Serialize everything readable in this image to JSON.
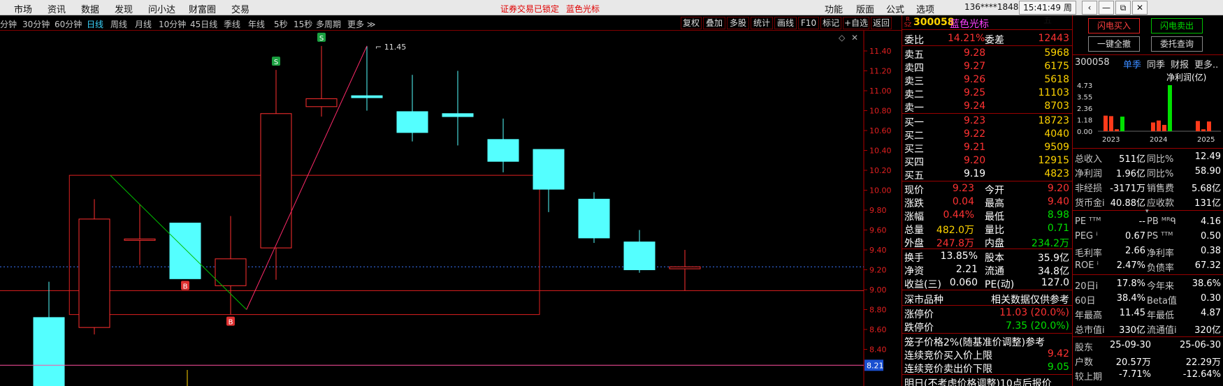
{
  "menu": [
    "市场",
    "资讯",
    "数据",
    "发现",
    "问小达",
    "财富圈",
    "交易"
  ],
  "notice": [
    "证券交易已锁定",
    "蓝色光标"
  ],
  "tools": [
    "功能",
    "版面",
    "公式",
    "选项"
  ],
  "user": "136****1848",
  "clock": "15:41:49 周五",
  "window_icons": [
    "back-icon",
    "minimize-icon",
    "restore-icon",
    "close-icon"
  ],
  "periods": [
    "分钟",
    "30分钟",
    "60分钟",
    "日线",
    "周线",
    "月线",
    "10分钟",
    "45日线",
    "季线",
    "年线",
    "5秒",
    "15秒",
    "多周期",
    "更多"
  ],
  "active_period": "日线",
  "chart_tools": [
    "复权",
    "叠加",
    "多股",
    "统计",
    "画线",
    "F10",
    "标记",
    "+自选",
    "返回"
  ],
  "chart_data": {
    "type": "candlestick",
    "y_ticks": [
      "11.40",
      "11.20",
      "11.00",
      "10.80",
      "10.60",
      "10.40",
      "10.20",
      "10.00",
      "9.80",
      "9.60",
      "9.40",
      "9.20",
      "9.00",
      "8.80",
      "8.60",
      "8.40",
      "8.21"
    ],
    "ylim": [
      8.22,
      11.5
    ],
    "current_price_line": 9.23,
    "support_line": 9.0,
    "crosshair_value": "8.21",
    "high_label": "11.45",
    "candles": [
      {
        "o": 8.72,
        "c": 7.55,
        "h": 9.08,
        "l": 7.2
      },
      {
        "o": 8.62,
        "c": 9.71,
        "h": 9.91,
        "l": 8.55
      },
      {
        "o": 9.51,
        "c": 9.51,
        "h": 9.86,
        "l": 9.25
      },
      {
        "o": 9.67,
        "c": 9.11,
        "h": 9.67,
        "l": 9.11
      },
      {
        "o": 9.04,
        "c": 9.31,
        "h": 9.74,
        "l": 8.75
      },
      {
        "o": 9.42,
        "c": 10.77,
        "h": 11.21,
        "l": 9.1
      },
      {
        "o": 10.84,
        "c": 10.92,
        "h": 11.45,
        "l": 10.74
      },
      {
        "o": 10.95,
        "c": 10.93,
        "h": 11.45,
        "l": 10.8
      },
      {
        "o": 10.79,
        "c": 10.58,
        "h": 11.16,
        "l": 10.49
      },
      {
        "o": 10.77,
        "c": 10.74,
        "h": 11.2,
        "l": 10.45
      },
      {
        "o": 10.51,
        "c": 10.29,
        "h": 10.72,
        "l": 10.18
      },
      {
        "o": 10.41,
        "c": 10.01,
        "h": 10.41,
        "l": 9.78
      },
      {
        "o": 9.91,
        "c": 9.52,
        "h": 9.98,
        "l": 9.47
      },
      {
        "o": 9.48,
        "c": 9.2,
        "h": 9.6,
        "l": 9.17
      },
      {
        "o": 9.21,
        "c": 9.23,
        "h": 9.4,
        "l": 8.99
      }
    ],
    "markers": [
      {
        "i": 3,
        "label": "B",
        "pos": "below"
      },
      {
        "i": 4,
        "label": "B",
        "pos": "below"
      },
      {
        "i": 5,
        "label": "S",
        "pos": "above"
      },
      {
        "i": 6,
        "label": "S",
        "pos": "above"
      }
    ],
    "boxes": [
      {
        "i0": 0.45,
        "i1": 10.8,
        "p_top": 10.15,
        "p_bot": 8.75
      },
      {
        "i0": -0.2,
        "i1": 18.6,
        "p_top": 8.99,
        "p_bot": 8.99
      }
    ],
    "lines": [
      {
        "color": "#00c000",
        "points": [
          [
            1.35,
            10.15
          ],
          [
            4.35,
            8.8
          ]
        ]
      },
      {
        "color": "#ff2a6a",
        "points": [
          [
            4.35,
            8.8
          ],
          [
            7.0,
            11.45
          ]
        ]
      }
    ]
  },
  "quote": {
    "exchange_badge": [
      "R",
      "SZ"
    ],
    "code": "300058",
    "name": "蓝色光标",
    "weibi": {
      "label": "委比",
      "value": "14.21%",
      "label2": "委差",
      "value2": "12443"
    },
    "asks": [
      {
        "label": "卖五",
        "price": "9.28",
        "vol": "5968"
      },
      {
        "label": "卖四",
        "price": "9.27",
        "vol": "6175"
      },
      {
        "label": "卖三",
        "price": "9.26",
        "vol": "5618"
      },
      {
        "label": "卖二",
        "price": "9.25",
        "vol": "11103"
      },
      {
        "label": "卖一",
        "price": "9.24",
        "vol": "8703"
      }
    ],
    "bids": [
      {
        "label": "买一",
        "price": "9.23",
        "vol": "18723"
      },
      {
        "label": "买二",
        "price": "9.22",
        "vol": "4040"
      },
      {
        "label": "买三",
        "price": "9.21",
        "vol": "9509"
      },
      {
        "label": "买四",
        "price": "9.20",
        "vol": "12915"
      },
      {
        "label": "买五",
        "price": "9.19",
        "vol": "4823"
      }
    ],
    "stats": [
      {
        "l1": "现价",
        "v1": "9.23",
        "c1": "red",
        "l2": "今开",
        "v2": "9.20",
        "c2": "red"
      },
      {
        "l1": "涨跌",
        "v1": "0.04",
        "c1": "red",
        "l2": "最高",
        "v2": "9.40",
        "c2": "red"
      },
      {
        "l1": "涨幅",
        "v1": "0.44%",
        "c1": "red",
        "l2": "最低",
        "v2": "8.98",
        "c2": "grn"
      },
      {
        "l1": "总量",
        "v1": "482.0万",
        "c1": "yel",
        "l2": "量比",
        "v2": "0.71",
        "c2": "grn"
      },
      {
        "l1": "外盘",
        "v1": "247.8万",
        "c1": "red",
        "l2": "内盘",
        "v2": "234.2万",
        "c2": "grn"
      }
    ],
    "stats2": [
      {
        "l1": "换手",
        "v1": "13.85%",
        "l2": "股本",
        "v2": "35.9亿"
      },
      {
        "l1": "净资",
        "v1": "2.21",
        "l2": "流通",
        "v2": "34.8亿"
      },
      {
        "l1": "收益(三)",
        "v1": "0.060",
        "l2": "PE(动)",
        "v2": "127.0"
      }
    ],
    "market": {
      "label": "深市品种",
      "note": "相关数据仅供参考"
    },
    "limits": [
      {
        "label": "涨停价",
        "value": "11.03 (20.0%)",
        "c": "red"
      },
      {
        "label": "跌停价",
        "value": "7.35 (20.0%)",
        "c": "grn"
      }
    ],
    "cage": {
      "label": "笼子价格2%(随基准价调整)参考"
    },
    "auction": [
      {
        "label": "连续竞价买入价上限",
        "value": "9.42",
        "c": "red"
      },
      {
        "label": "连续竞价卖出价下限",
        "value": "9.05",
        "c": "grn"
      }
    ],
    "footer": "明日(不考虑价格调整)10点后报价"
  },
  "trade_buttons": {
    "flash_buy": "闪电买入",
    "flash_sell": "闪电卖出",
    "cancel_all": "一键全撤",
    "query": "委托查询"
  },
  "fin": {
    "code": "300058",
    "tabs": [
      "单季",
      "同季",
      "财报",
      "更多.."
    ],
    "metric": "净利润(亿)",
    "yticks": [
      "4.73",
      "3.55",
      "2.36",
      "1.18",
      "0.00"
    ],
    "years": [
      "2023",
      "2024",
      "2025"
    ],
    "bars": [
      {
        "v": 1.6,
        "c": "#ff3a1a"
      },
      {
        "v": 1.55,
        "c": "#ff3a1a"
      },
      {
        "v": 0.2,
        "c": "#ff3a1a"
      },
      {
        "v": 1.5,
        "c": "#00e000"
      },
      {
        "v": 0.9,
        "c": "#ff3a1a"
      },
      {
        "v": 1.1,
        "c": "#ff3a1a"
      },
      {
        "v": 0.65,
        "c": "#ff3a1a"
      },
      {
        "v": 4.73,
        "c": "#00e000"
      },
      {
        "v": 1.05,
        "c": "#ff3a1a"
      },
      {
        "v": 0.2,
        "c": "#ff3a1a"
      },
      {
        "v": 1.0,
        "c": "#ff3a1a"
      }
    ],
    "rows1": [
      {
        "l1": "总收入",
        "v1": "511亿",
        "l2": "同比%",
        "v2": "12.49"
      },
      {
        "l1": "净利润",
        "v1": "1.96亿",
        "l2": "同比%",
        "v2": "58.90"
      },
      {
        "l1": "非经损",
        "v1": "-3171万",
        "l2": "销售费",
        "v2": "5.68亿"
      },
      {
        "l1": "货币金i",
        "v1": "40.88亿",
        "l2": "应收款",
        "v2": "131亿"
      }
    ],
    "rows2": [
      {
        "l1": "PE ᵀᵀᴹ",
        "v1": "--",
        "l2": "PB ᴹᴿᑫ",
        "v2": "4.16"
      },
      {
        "l1": "PEG ⁱ",
        "v1": "0.67",
        "l2": "PS ᵀᵀᴹ",
        "v2": "0.50"
      },
      {
        "l1": "毛利率",
        "v1": "2.66",
        "l2": "净利率",
        "v2": "0.38"
      },
      {
        "l1": "ROE ⁱ",
        "v1": "2.47%",
        "l2": "负债率",
        "v2": "67.32"
      }
    ],
    "rows3": [
      {
        "l1": "20日i",
        "v1": "17.8%",
        "l2": "今年来",
        "v2": "38.6%"
      },
      {
        "l1": "60日",
        "v1": "38.4%",
        "l2": "Beta值",
        "v2": "0.30"
      },
      {
        "l1": "年最高",
        "v1": "11.45",
        "l2": "年最低",
        "v2": "4.87"
      },
      {
        "l1": "总市值i",
        "v1": "330亿",
        "l2": "流通值i",
        "v2": "320亿"
      }
    ],
    "rows4": [
      {
        "l1": "股东",
        "v1": "25-09-30",
        "v2": "25-06-30"
      },
      {
        "l1": "户数",
        "v1": "20.57万",
        "v2": "22.29万"
      },
      {
        "l1": "较上期",
        "v1": "-7.71%",
        "v2": "-12.64%"
      }
    ]
  }
}
